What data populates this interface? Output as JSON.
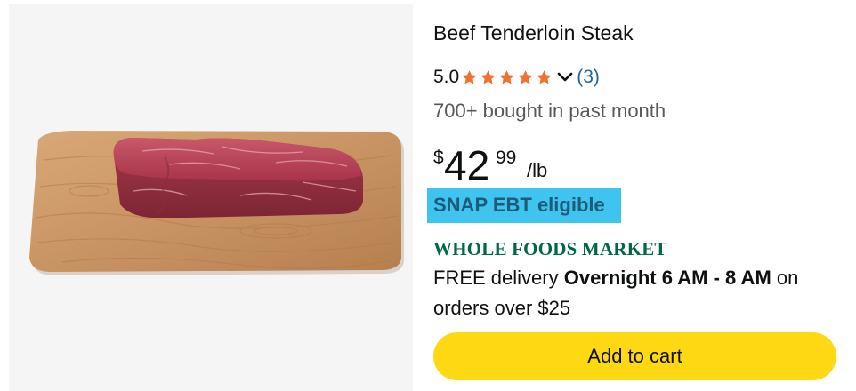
{
  "product": {
    "image_alt": "Beef tenderloin steak on a wooden cutting board",
    "title": "Beef Tenderloin Steak",
    "rating": {
      "value": "5.0",
      "stars": 5,
      "star_color": "#f3702d",
      "count_label": "(3)",
      "expand_icon": "chevron-down-icon"
    },
    "bought_text": "700+ bought in past month",
    "price": {
      "symbol": "$",
      "whole": "42",
      "fraction": "99",
      "unit": "/lb"
    },
    "snap_badge": "SNAP EBT eligible",
    "store_logo": "WHOLE FOODS MARKET",
    "delivery": {
      "prefix": "FREE delivery",
      "window": "Overnight 6 AM - 8 AM",
      "suffix": "on orders over $25"
    },
    "add_to_cart_label": "Add to cart"
  },
  "colors": {
    "snap_badge_bg": "#3ec4ef",
    "button_bg": "#ffd814",
    "link": "#2162a1",
    "wfm_green": "#00674b"
  }
}
